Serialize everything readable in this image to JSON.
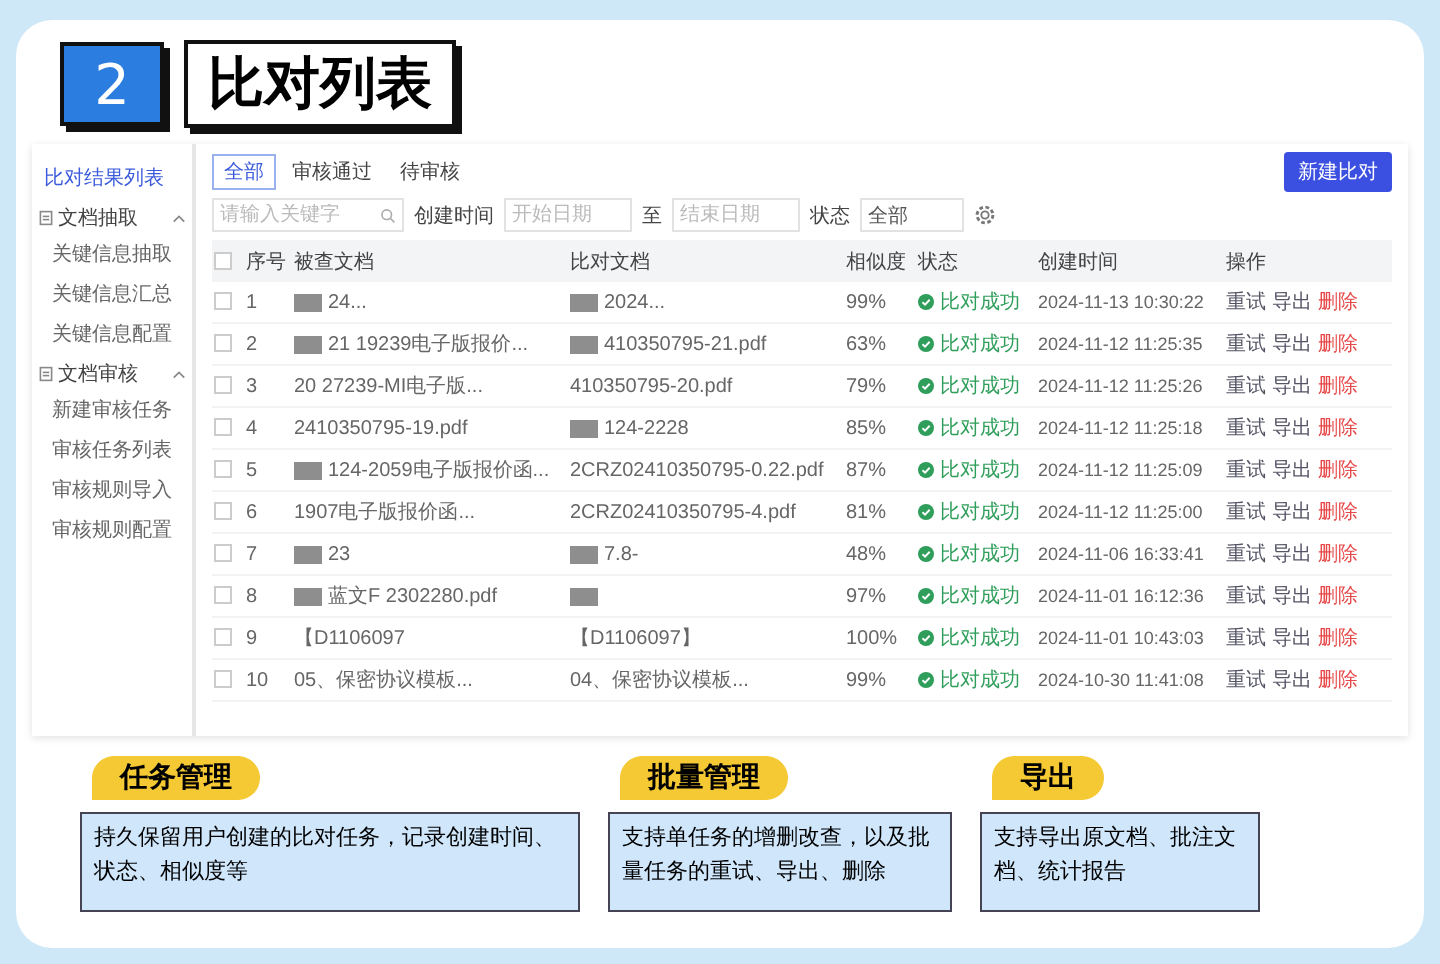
{
  "header": {
    "number": "2",
    "title": "比对列表"
  },
  "app": {
    "sidebar": {
      "items": [
        {
          "kind": "link",
          "label": "比对结果列表",
          "selected": true
        },
        {
          "kind": "group",
          "label": "文档抽取",
          "expanded": true,
          "children": [
            {
              "label": "关键信息抽取",
              "selected": false
            },
            {
              "label": "关键信息汇总",
              "selected": false
            },
            {
              "label": "关键信息配置",
              "selected": false
            }
          ]
        },
        {
          "kind": "group",
          "label": "文档审核",
          "expanded": true,
          "children": [
            {
              "label": "新建审核任务",
              "selected": false
            },
            {
              "label": "审核任务列表",
              "selected": false
            },
            {
              "label": "审核规则导入",
              "selected": false
            },
            {
              "label": "审核规则配置",
              "selected": false
            }
          ]
        }
      ]
    },
    "tabs": [
      {
        "label": "全部",
        "selected": true
      },
      {
        "label": "审核通过",
        "selected": false
      },
      {
        "label": "待审核",
        "selected": false
      }
    ],
    "new_button": "新建比对",
    "filters": {
      "search_placeholder": "请输入关键字",
      "date_label": "创建时间",
      "start_placeholder": "开始日期",
      "range_separator": "至",
      "end_placeholder": "结束日期",
      "status_label": "状态",
      "status_value": "全部"
    },
    "table": {
      "columns": [
        "序号",
        "被查文档",
        "比对文档",
        "相似度",
        "状态",
        "创建时间",
        "操作"
      ],
      "header_checked": false,
      "rows": [
        {
          "checked": false,
          "index": "1",
          "doc": {
            "text": "24...",
            "redacted": true
          },
          "compare": {
            "text": "2024...",
            "redacted": true
          },
          "similarity": "99%",
          "status": "比对成功",
          "created": "2024-11-13 10:30:22",
          "actions": [
            "重试",
            "导出",
            "删除"
          ]
        },
        {
          "checked": false,
          "index": "2",
          "doc": {
            "text": "21 19239电子版报价...",
            "redacted": true
          },
          "compare": {
            "text": "410350795-21.pdf",
            "redacted": true
          },
          "similarity": "63%",
          "status": "比对成功",
          "created": "2024-11-12 11:25:35",
          "actions": [
            "重试",
            "导出",
            "删除"
          ]
        },
        {
          "checked": false,
          "index": "3",
          "doc": {
            "text": "20 27239-MI电子版...",
            "redacted": false
          },
          "compare": {
            "text": "410350795-20.pdf",
            "redacted": false
          },
          "similarity": "79%",
          "status": "比对成功",
          "created": "2024-11-12 11:25:26",
          "actions": [
            "重试",
            "导出",
            "删除"
          ]
        },
        {
          "checked": false,
          "index": "4",
          "doc": {
            "text": "2410350795-19.pdf",
            "redacted": false
          },
          "compare": {
            "text": "124-2228",
            "redacted": true
          },
          "similarity": "85%",
          "status": "比对成功",
          "created": "2024-11-12 11:25:18",
          "actions": [
            "重试",
            "导出",
            "删除"
          ]
        },
        {
          "checked": false,
          "index": "5",
          "doc": {
            "text": "124-2059电子版报价函...",
            "redacted": true
          },
          "compare": {
            "text": "2CRZ02410350795-0.22.pdf",
            "redacted": false
          },
          "similarity": "87%",
          "status": "比对成功",
          "created": "2024-11-12 11:25:09",
          "actions": [
            "重试",
            "导出",
            "删除"
          ]
        },
        {
          "checked": false,
          "index": "6",
          "doc": {
            "text": "1907电子版报价函...",
            "redacted": false
          },
          "compare": {
            "text": "2CRZ02410350795-4.pdf",
            "redacted": false
          },
          "similarity": "81%",
          "status": "比对成功",
          "created": "2024-11-12 11:25:00",
          "actions": [
            "重试",
            "导出",
            "删除"
          ]
        },
        {
          "checked": false,
          "index": "7",
          "doc": {
            "text": "23",
            "redacted": true
          },
          "compare": {
            "text": "7.8-",
            "redacted": true
          },
          "similarity": "48%",
          "status": "比对成功",
          "created": "2024-11-06 16:33:41",
          "actions": [
            "重试",
            "导出",
            "删除"
          ]
        },
        {
          "checked": false,
          "index": "8",
          "doc": {
            "text": "蓝文F 2302280.pdf",
            "redacted": true
          },
          "compare": {
            "redacted": true
          },
          "similarity": "97%",
          "status": "比对成功",
          "created": "2024-11-01 16:12:36",
          "actions": [
            "重试",
            "导出",
            "删除"
          ]
        },
        {
          "checked": false,
          "index": "9",
          "doc": {
            "text": "【D1106097",
            "redacted": false
          },
          "compare": {
            "text": "【D1106097】",
            "redacted": false
          },
          "similarity": "100%",
          "status": "比对成功",
          "created": "2024-11-01 10:43:03",
          "actions": [
            "重试",
            "导出",
            "删除"
          ]
        },
        {
          "checked": false,
          "index": "10",
          "doc": {
            "text": "05、保密协议模板...",
            "redacted": false
          },
          "compare": {
            "text": "04、保密协议模板...",
            "redacted": false
          },
          "similarity": "99%",
          "status": "比对成功",
          "created": "2024-10-30 11:41:08",
          "actions": [
            "重试",
            "导出",
            "删除"
          ]
        }
      ]
    }
  },
  "features": [
    {
      "title": "任务管理",
      "description": "持久保留用户创建的比对任务，记录创建时间、状态、相似度等"
    },
    {
      "title": "批量管理",
      "description": "支持单任务的增删改查，以及批量任务的重试、导出、删除"
    },
    {
      "title": "导出",
      "description": "支持导出原文档、批注文档、统计报告"
    }
  ]
}
